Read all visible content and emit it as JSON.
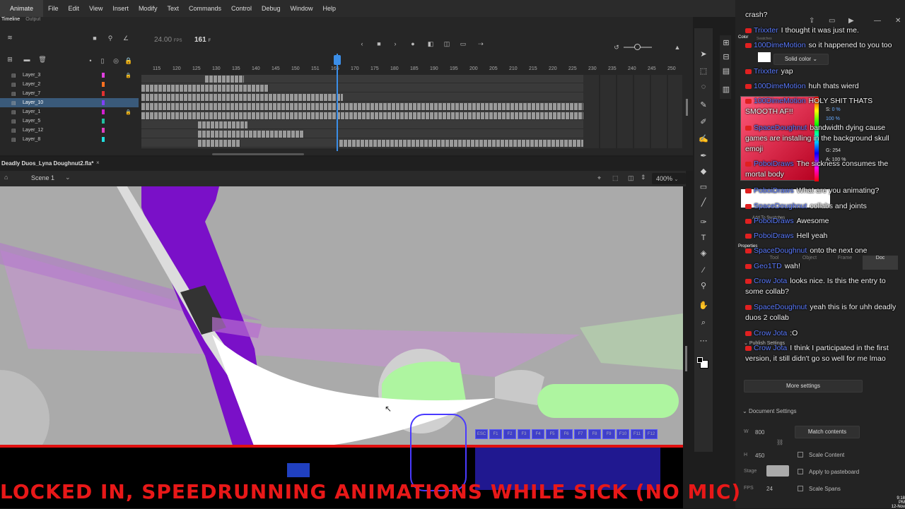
{
  "menubar": {
    "app": "Animate",
    "menus": [
      "File",
      "Edit",
      "View",
      "Insert",
      "Modify",
      "Text",
      "Commands",
      "Control",
      "Debug",
      "Window",
      "Help"
    ]
  },
  "timeline": {
    "tabs": [
      "Timeline",
      "Output"
    ],
    "fps": "24.00",
    "fps_unit": "FPS",
    "current_frame": "161",
    "frame_unit": "F",
    "ruler_ticks": [
      "115",
      "120",
      "125",
      "130",
      "135",
      "140",
      "145",
      "150",
      "151",
      "165",
      "170",
      "175",
      "180",
      "185",
      "190",
      "195",
      "200",
      "205",
      "210",
      "215",
      "220",
      "225",
      "230",
      "235",
      "240",
      "245",
      "250"
    ],
    "layers": [
      {
        "name": "Layer_3",
        "color": "#e040e0",
        "selected": false
      },
      {
        "name": "Layer_2",
        "color": "#ff7020",
        "selected": false
      },
      {
        "name": "Layer_7",
        "color": "#e03030",
        "selected": false
      },
      {
        "name": "Layer_10",
        "color": "#8040ff",
        "selected": true
      },
      {
        "name": "Layer_1",
        "color": "#d020d0",
        "selected": false
      },
      {
        "name": "Layer_5",
        "color": "#20c0a0",
        "selected": false
      },
      {
        "name": "Layer_12",
        "color": "#e040c0",
        "selected": false
      },
      {
        "name": "Layer_8",
        "color": "#20e0e0",
        "selected": false
      }
    ]
  },
  "document": {
    "tab_title": "Deadly Duos_Lyna Doughnut2.fla*",
    "scene": "Scene 1",
    "zoom": "400%"
  },
  "chat": [
    {
      "user": "",
      "text": "crash?"
    },
    {
      "user": "Trixxter",
      "text": "I thought it was just me."
    },
    {
      "user": "100DimeMotion",
      "text": "so it happened to you too"
    },
    {
      "user": "Trixxter",
      "text": "yap"
    },
    {
      "user": "100DimeMotion",
      "text": "huh thats wierd"
    },
    {
      "user": "100DimeMotion",
      "text": "HOLY SHIT THATS SMOOTH AF!!"
    },
    {
      "user": "SpaceDoughnut",
      "text": "bandwidth dying cause games are installing in the background skull emoji"
    },
    {
      "user": "PoboiDraws",
      "text": "The sickness consumes the mortal body"
    },
    {
      "user": "PoboiDraws",
      "text": "What are you animating?"
    },
    {
      "user": "SpaceDoughnut",
      "text": "collabs and joints"
    },
    {
      "user": "PoboiDraws",
      "text": "Awesome"
    },
    {
      "user": "PoboiDraws",
      "text": "Hell yeah"
    },
    {
      "user": "SpaceDoughnut",
      "text": "onto the next one"
    },
    {
      "user": "Geo1TD",
      "text": "wah!"
    },
    {
      "user": "Crow Jota",
      "text": "looks nice. Is this the entry to some collab?"
    },
    {
      "user": "SpaceDoughnut",
      "text": "yeah this is for uhh deadly duos 2 collab"
    },
    {
      "user": "Crow Jota",
      "text": ":O"
    },
    {
      "user": "Crow Jota",
      "text": "I think I participated in the first version, it still didn't go so well for me lmao"
    }
  ],
  "properties": {
    "color_panel": "Color",
    "swatches": "Swatches",
    "solid_color": "Solid color",
    "hsb": {
      "s_label": "S:",
      "s_val": "0 %",
      "b_val": "100 %"
    },
    "rgb": {
      "g_label": "G:",
      "g_val": "254",
      "a_label": "A:",
      "a_val": "100 %"
    },
    "add_to_swatches": "Add To Swatches",
    "properties_title": "Properties",
    "tabs": [
      "Tool",
      "Object",
      "Frame",
      "Doc"
    ],
    "publish_settings": "Publish Settings",
    "more_settings": "More settings",
    "document_settings": "Document Settings",
    "width_label": "W",
    "width": "800",
    "height_label": "H",
    "height": "450",
    "match_contents": "Match contents",
    "scale_content": "Scale Content",
    "stage_label": "Stage",
    "apply_to_pasteboard": "Apply to pasteboard",
    "fps_label": "FPS",
    "fps": "24",
    "scale_spans": "Scale Spans"
  },
  "overlay": {
    "banner": "LOCKED IN, SPEEDRUNNING ANIMATIONS WHILE SICK (NO MIC)",
    "keys": [
      "ESC",
      "F1",
      "F2",
      "F3",
      "F4",
      "F5",
      "F6",
      "F7",
      "F8",
      "F9",
      "F10",
      "F11",
      "F12"
    ]
  },
  "clock": {
    "time": "9:18 PM",
    "date": "12-Nov"
  },
  "colors": {
    "accent": "#3b8ee8",
    "purple": "#7a10c8",
    "red": "#e81818",
    "green": "#aef5a0"
  }
}
